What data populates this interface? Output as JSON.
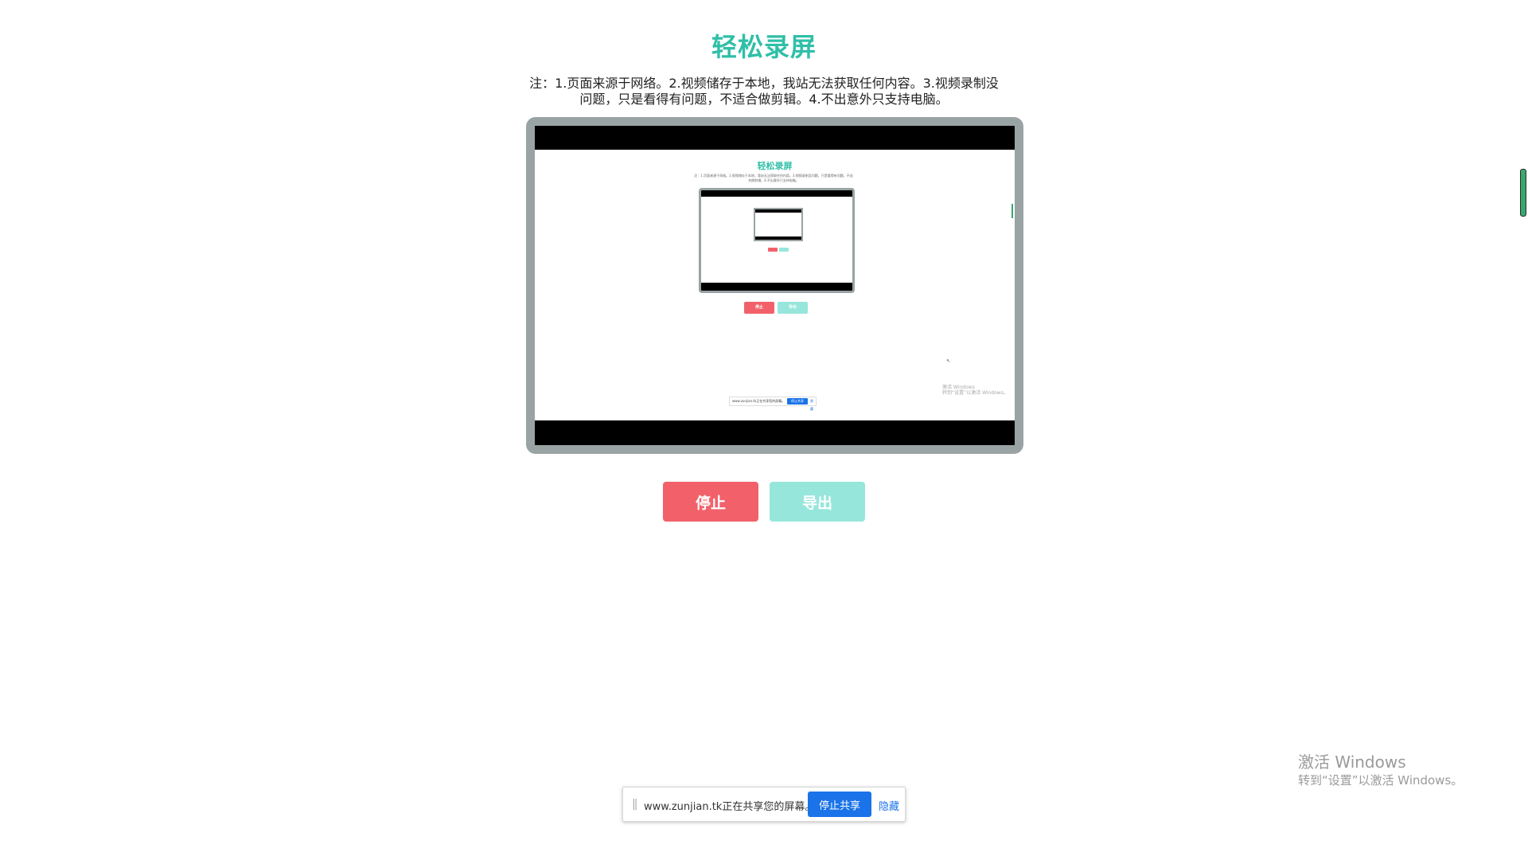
{
  "app": {
    "title": "轻松录屏",
    "note": "注：1.页面来源于网络。2.视频储存于本地，我站无法获取任何内容。3.视频录制没问题，只是看得有问题，不适合做剪辑。4.不出意外只支持电脑。"
  },
  "buttons": {
    "stop_label": "停止",
    "export_label": "导出"
  },
  "share_bar": {
    "grip": "||",
    "message": "www.zunjian.tk正在共享您的屏幕。",
    "stop_label": "停止共享",
    "hide_label": "隐藏"
  },
  "watermark": {
    "line1": "激活 Windows",
    "line2": "转到“设置”以激活 Windows。"
  },
  "colors": {
    "title": "#2fbfa8",
    "stop": "#f2616a",
    "export": "#97e6db",
    "share_blue": "#1a73e8",
    "frame_border": "#9aa3a3"
  }
}
